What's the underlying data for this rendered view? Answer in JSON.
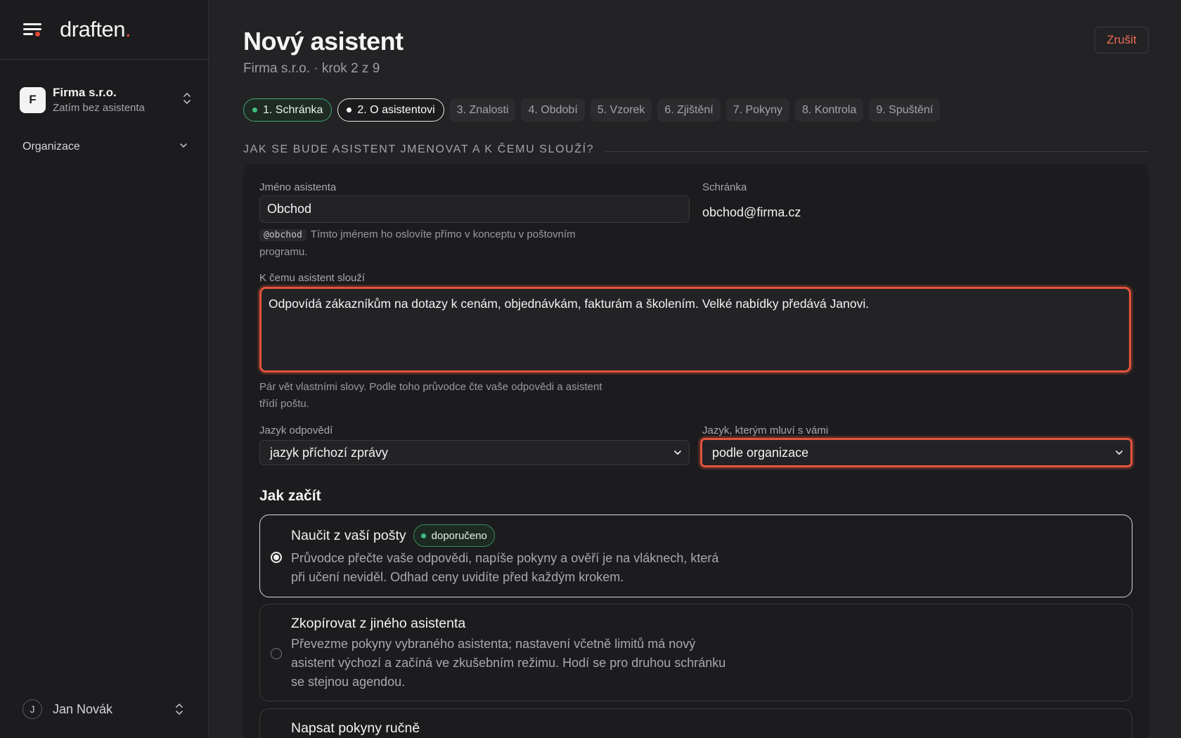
{
  "app": {
    "logo": "draften",
    "logo_dot": "."
  },
  "sidebar": {
    "org_avatar": "F",
    "org_name": "Firma s.r.o.",
    "org_sub": "Zatím bez asistenta",
    "nav_org": "Organizace",
    "user_avatar": "J",
    "user_name": "Jan Novák"
  },
  "header": {
    "title": "Nový asistent",
    "subtitle": "Firma s.r.o. · krok 2 z 9",
    "cancel_label": "Zrušit"
  },
  "steps": [
    {
      "label": "1. Schránka",
      "state": "done"
    },
    {
      "label": "2. O asistentovi",
      "state": "active"
    },
    {
      "label": "3. Znalosti",
      "state": "todo"
    },
    {
      "label": "4. Období",
      "state": "todo"
    },
    {
      "label": "5. Vzorek",
      "state": "todo"
    },
    {
      "label": "6. Zjištění",
      "state": "todo"
    },
    {
      "label": "7. Pokyny",
      "state": "todo"
    },
    {
      "label": "8. Kontrola",
      "state": "todo"
    },
    {
      "label": "9. Spuštění",
      "state": "todo"
    }
  ],
  "form": {
    "section_label": "JAK SE BUDE ASISTENT JMENOVAT A K ČEMU SLOUŽÍ?",
    "name_label": "Jméno asistenta",
    "name_value": "Obchod",
    "mailbox_label": "Schránka",
    "mailbox_value": "obchod@firma.cz",
    "mention": "@obchod",
    "name_hint": "Tímto jménem ho oslovíte přímo v konceptu v poštovním programu.",
    "purpose_label": "K čemu asistent slouží",
    "purpose_value": "Odpovídá zákazníkům na dotazy k cenám, objednávkám, fakturám a školením. Velké nabídky předává Janovi.",
    "purpose_hint": "Pár vět vlastními slovy. Podle toho průvodce čte vaše odpovědi a asistent třídí poštu.",
    "reply_lang_label": "Jazyk odpovědí",
    "reply_lang_value": "jazyk příchozí zprávy",
    "ui_lang_label": "Jazyk, kterým mluví s vámi",
    "ui_lang_value": "podle organizace"
  },
  "start": {
    "heading": "Jak začít",
    "options": [
      {
        "title": "Naučit z vaší pošty",
        "badge": "doporučeno",
        "desc": "Průvodce přečte vaše odpovědi, napíše pokyny a ověří je na vláknech, která při učení neviděl. Odhad ceny uvidíte před každým krokem.",
        "selected": true
      },
      {
        "title": "Zkopírovat z jiného asistenta",
        "desc": "Převezme pokyny vybraného asistenta; nastavení včetně limitů má nový asistent výchozí a začíná ve zkušebním režimu. Hodí se pro druhou schránku se stejnou agendou.",
        "selected": false
      },
      {
        "title": "Napsat pokyny ručně",
        "desc": "",
        "selected": false
      }
    ]
  },
  "colors": {
    "accent_red": "#e4533d",
    "accent_green": "#3fbf7f",
    "bg": "#232325",
    "panel": "#1c1c1e"
  }
}
